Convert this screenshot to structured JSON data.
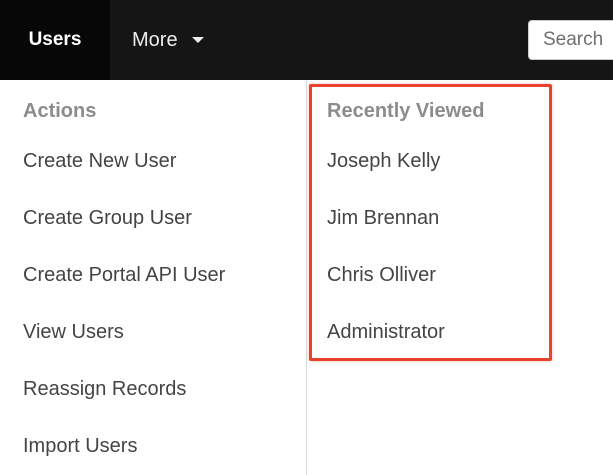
{
  "nav": {
    "users_label": "Users",
    "more_label": "More",
    "search_placeholder": "Search"
  },
  "actions": {
    "header": "Actions",
    "items": [
      {
        "label": "Create New User"
      },
      {
        "label": "Create Group User"
      },
      {
        "label": "Create Portal API User"
      },
      {
        "label": "View Users"
      },
      {
        "label": "Reassign Records"
      },
      {
        "label": "Import Users"
      }
    ]
  },
  "recent": {
    "header": "Recently Viewed",
    "items": [
      {
        "label": "Joseph Kelly"
      },
      {
        "label": "Jim Brennan"
      },
      {
        "label": "Chris Olliver"
      },
      {
        "label": "Administrator"
      }
    ]
  },
  "colors": {
    "navbar": "#151515",
    "active_tab": "#070707",
    "highlight": "#e8412c",
    "header_text": "#8c8c8c",
    "item_text": "#444444"
  }
}
